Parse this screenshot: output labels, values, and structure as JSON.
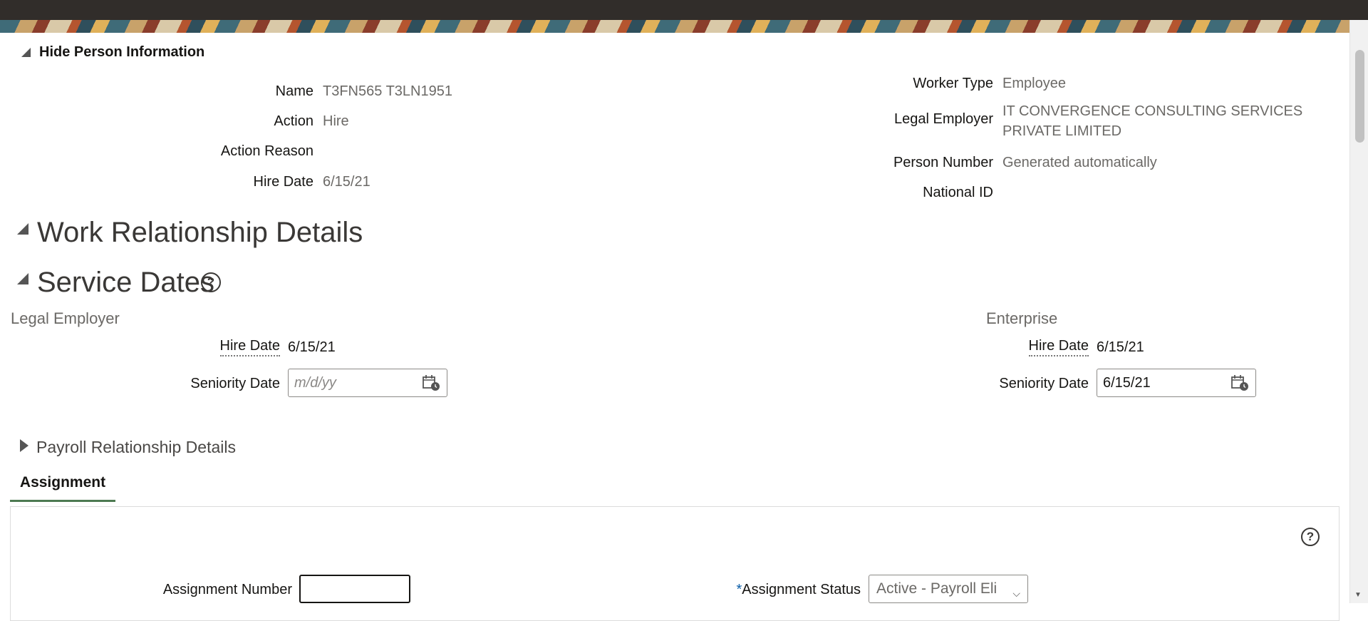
{
  "person_info": {
    "toggle_label": "Hide Person Information",
    "name_label": "Name",
    "name_value": "T3FN565 T3LN1951",
    "action_label": "Action",
    "action_value": "Hire",
    "action_reason_label": "Action Reason",
    "action_reason_value": "",
    "hire_date_label": "Hire Date",
    "hire_date_value": "6/15/21",
    "worker_type_label": "Worker Type",
    "worker_type_value": "Employee",
    "legal_employer_label": "Legal Employer",
    "legal_employer_value_line1": "IT CONVERGENCE CONSULTING SERVICES",
    "legal_employer_value_line2": "PRIVATE LIMITED",
    "person_number_label": "Person Number",
    "person_number_value": "Generated automatically",
    "national_id_label": "National ID",
    "national_id_value": ""
  },
  "work_relationship": {
    "title": "Work Relationship Details"
  },
  "service_dates": {
    "title": "Service Dates",
    "help_icon": "help-circle-icon",
    "legal_employer": {
      "heading": "Legal Employer",
      "hire_date_label": "Hire Date",
      "hire_date_value": "6/15/21",
      "seniority_label": "Seniority Date",
      "seniority_value": "",
      "seniority_placeholder": "m/d/yy"
    },
    "enterprise": {
      "heading": "Enterprise",
      "hire_date_label": "Hire Date",
      "hire_date_value": "6/15/21",
      "seniority_label": "Seniority Date",
      "seniority_value": "6/15/21"
    }
  },
  "payroll_relationship": {
    "title": "Payroll Relationship Details"
  },
  "assignment": {
    "tab_label": "Assignment",
    "assignment_number_label": "Assignment Number",
    "assignment_number_value": "",
    "assignment_status_required": "*",
    "assignment_status_label": "Assignment Status",
    "assignment_status_value": "Active - Payroll Eli",
    "help_icon": "help-circle-icon"
  },
  "colors": {
    "top_bar": "#312d2a",
    "tab_underline": "#4d7a52",
    "required_marker": "#0b5ea8"
  }
}
